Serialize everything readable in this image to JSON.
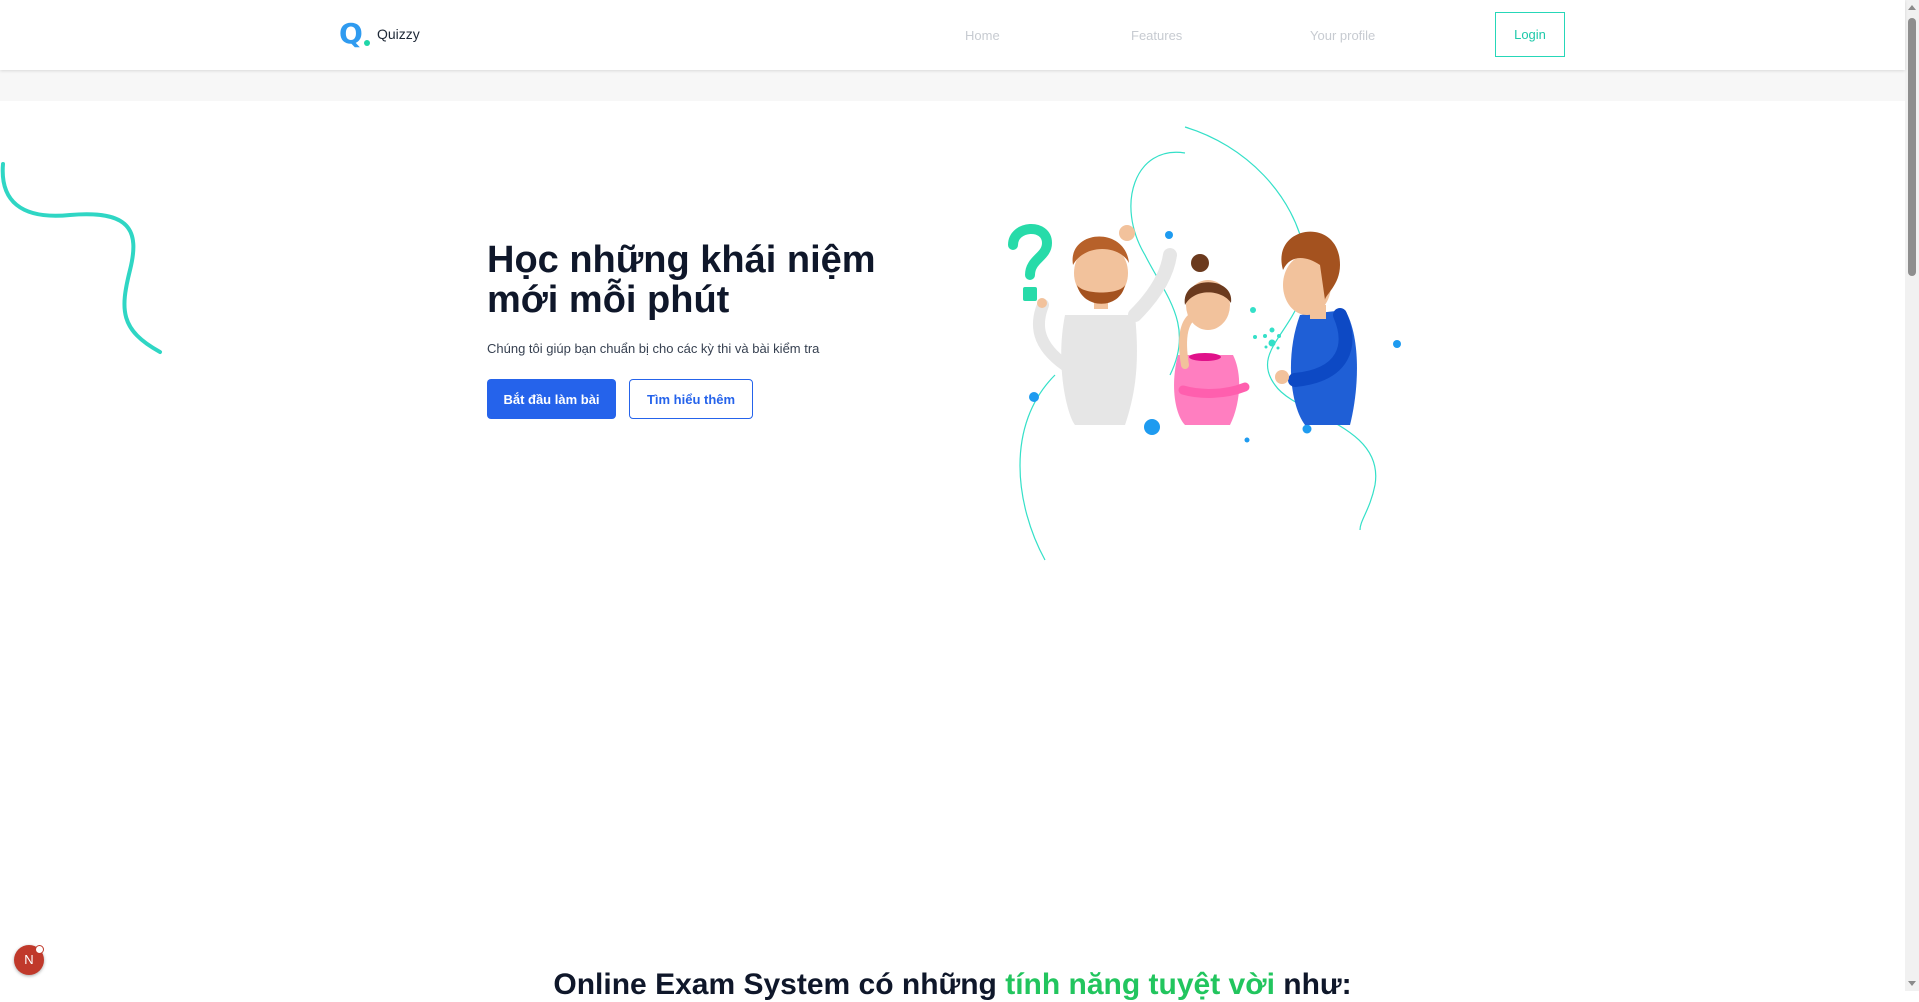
{
  "header": {
    "brand": "Quizzy",
    "logo_letter": "Q",
    "nav": [
      {
        "label": "Home"
      },
      {
        "label": "Features"
      },
      {
        "label": "Your profile"
      }
    ],
    "login_label": "Login"
  },
  "hero": {
    "title": "Học những khái niệm mới mỗi phút",
    "subtitle": "Chúng tôi giúp bạn chuẩn bị cho các kỳ thi và bài kiểm tra",
    "primary_button": "Bắt đầu làm bài",
    "secondary_button": "Tìm hiểu thêm"
  },
  "features_heading": {
    "prefix": "Online Exam System có những ",
    "highlight": "tính năng tuyệt vời",
    "suffix": " như:"
  },
  "dev_badge": {
    "letter": "N"
  },
  "colors": {
    "accent": "#2563eb",
    "teal": "#26d7b8",
    "highlight_green": "#22c55e",
    "logo_blue": "#2f9bf0"
  }
}
